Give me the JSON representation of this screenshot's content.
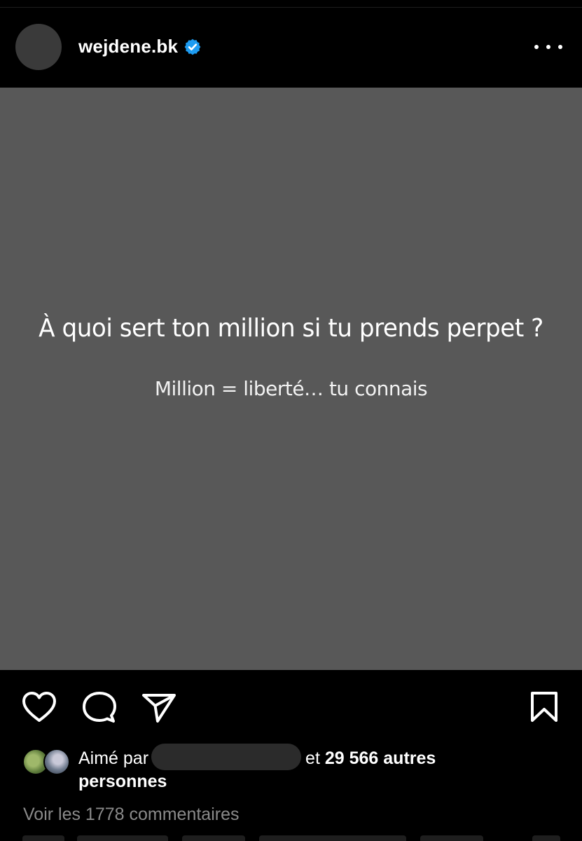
{
  "header": {
    "username": "wejdene.bk",
    "verified_icon": "verified-badge-icon",
    "more_icon": "more-options-icon",
    "accent_color": "#1d9bf0"
  },
  "post": {
    "background_color": "#585858",
    "headline": "À quoi sert ton million si tu prends perpet ?",
    "subline": "Million = liberté… tu connais"
  },
  "actions": {
    "like_icon": "heart-icon",
    "comment_icon": "comment-icon",
    "share_icon": "share-icon",
    "save_icon": "bookmark-icon"
  },
  "likes": {
    "prefix": "Aimé par",
    "connector": "et",
    "count_text": "29 566 autres",
    "suffix": "personnes"
  },
  "comments": {
    "link_text": "Voir les 1778 commentaires"
  }
}
